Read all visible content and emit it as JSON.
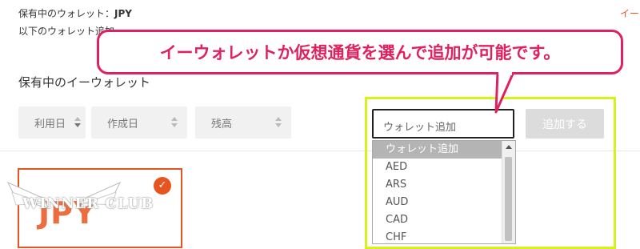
{
  "header": {
    "held_wallet_label": "保有中のウォレット：",
    "held_wallet_value": "JPY",
    "add_info_text": "以下のウォレット追加",
    "top_right_link": "イー"
  },
  "section": {
    "title": "保有中のイーウォレット"
  },
  "sort_controls": [
    {
      "label": "利用日"
    },
    {
      "label": "作成日"
    },
    {
      "label": "残高"
    }
  ],
  "add_wallet": {
    "select_value": "ウォレット追加",
    "button_label": "追加する",
    "options": [
      "ウォレット追加",
      "AED",
      "ARS",
      "AUD",
      "CAD",
      "CHF"
    ],
    "selected_index": 0
  },
  "wallet_card": {
    "currency": "JPY",
    "check_symbol": "✓",
    "accent_color": "#e8541f"
  },
  "watermark": {
    "text": "WINNER CLUB"
  },
  "callout": {
    "text": "イーウォレットか仮想通貨を選んで追加が可能です。",
    "color": "#e0215e",
    "highlight_color": "#d6f21d"
  }
}
